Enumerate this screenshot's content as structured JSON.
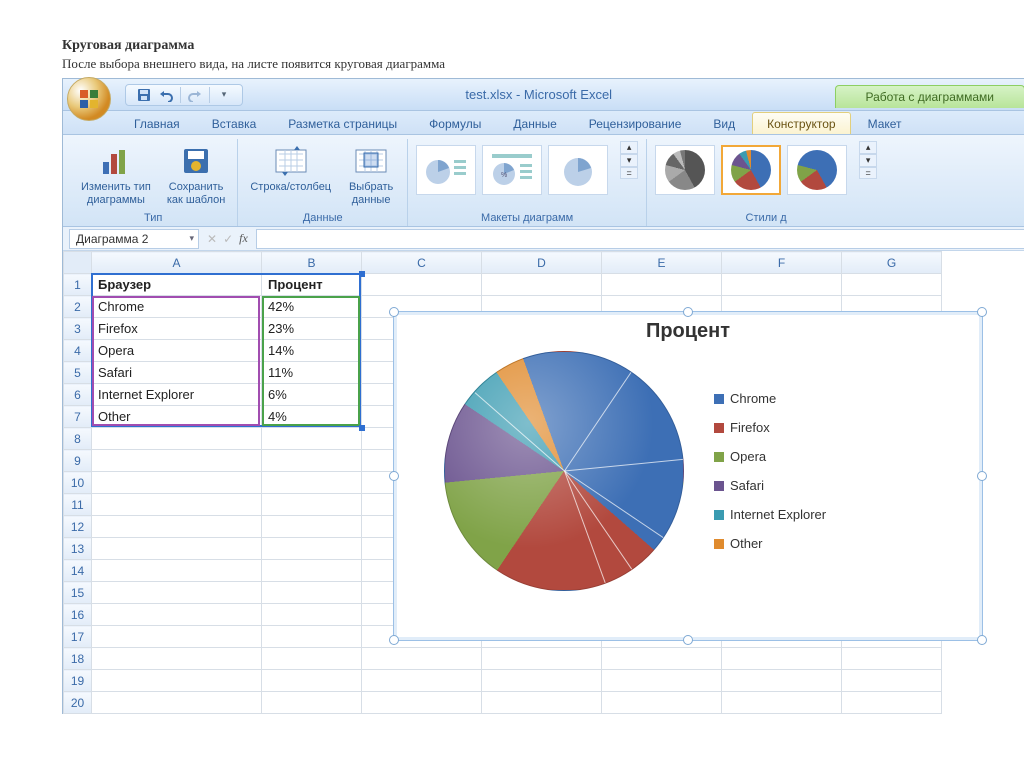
{
  "doc": {
    "heading": "Круговая диаграмма",
    "sub": "После выбора внешнего вида, на листе появится круговая диаграмма"
  },
  "titlebar": {
    "title": "test.xlsx - Microsoft Excel",
    "context_title": "Работа с диаграммами"
  },
  "tabs": {
    "items": [
      "Главная",
      "Вставка",
      "Разметка страницы",
      "Формулы",
      "Данные",
      "Рецензирование",
      "Вид",
      "Конструктор",
      "Макет"
    ],
    "active_index": 7
  },
  "ribbon": {
    "group_type": "Тип",
    "btn_change_type": "Изменить тип\nдиаграммы",
    "btn_save_template": "Сохранить\nкак шаблон",
    "group_data": "Данные",
    "btn_switch": "Строка/столбец",
    "btn_select": "Выбрать\nданные",
    "group_layouts": "Макеты диаграмм",
    "group_styles": "Стили д"
  },
  "fxrow": {
    "namebox": "Диаграмма 2",
    "fx_label": "fx"
  },
  "grid": {
    "columns": [
      "A",
      "B",
      "C",
      "D",
      "E",
      "F",
      "G"
    ],
    "rows_shown": 20,
    "header": {
      "a": "Браузер",
      "b": "Процент"
    },
    "data": [
      {
        "a": "Chrome",
        "b": "42%"
      },
      {
        "a": "Firefox",
        "b": "23%"
      },
      {
        "a": "Opera",
        "b": "14%"
      },
      {
        "a": "Safari",
        "b": "11%"
      },
      {
        "a": "Internet Explorer",
        "b": "6%"
      },
      {
        "a": "Other",
        "b": "4%"
      }
    ]
  },
  "chart": {
    "title": "Процент"
  },
  "chart_data": {
    "type": "pie",
    "title": "Процент",
    "categories": [
      "Chrome",
      "Firefox",
      "Opera",
      "Safari",
      "Internet Explorer",
      "Other"
    ],
    "values": [
      42,
      23,
      14,
      11,
      6,
      4
    ],
    "colors": [
      "#3d6fb5",
      "#b2493e",
      "#80a348",
      "#6b548f",
      "#3a9bb1",
      "#e08b2e"
    ],
    "legend_position": "right"
  }
}
